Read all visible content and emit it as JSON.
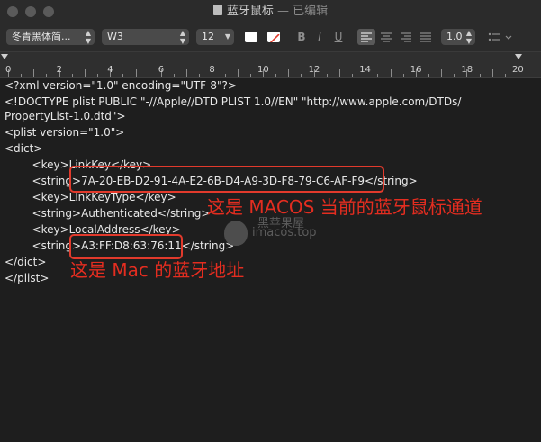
{
  "window": {
    "title": "蓝牙鼠标",
    "title_sep": "—",
    "status": "已编辑"
  },
  "toolbar": {
    "font_family": "冬青黑体简...",
    "font_weight": "W3",
    "font_size": "12",
    "bold": "B",
    "italic": "I",
    "underline": "U",
    "line_spacing": "1.0"
  },
  "ruler": {
    "labels": [
      "0",
      "2",
      "4",
      "6",
      "8",
      "10",
      "12",
      "14",
      "16",
      "18",
      "20"
    ]
  },
  "document": {
    "lines": [
      "<?xml version=\"1.0\" encoding=\"UTF-8\"?>",
      "<!DOCTYPE plist PUBLIC \"-//Apple//DTD PLIST 1.0//EN\" \"http://www.apple.com/DTDs/",
      "PropertyList-1.0.dtd\">",
      "<plist version=\"1.0\">",
      "<dict>",
      "        <key>LinkKey</key>",
      "        <string>7A-20-EB-D2-91-4A-E2-6B-D4-A9-3D-F8-79-C6-AF-F9</string>",
      "        <key>LinkKeyType</key>",
      "        <string>Authenticated</string>",
      "        <key>LocalAddress</key>",
      "        <string>A3:FF:D8:63:76:11</string>",
      "</dict>",
      "</plist>"
    ]
  },
  "annotations": {
    "link_key_note": "这是 MACOS 当前的蓝牙鼠标通道",
    "address_note": "这是 Mac 的蓝牙地址",
    "color": "#e23a2c"
  },
  "watermark": {
    "line1": "黑苹果屋",
    "line2": "imacos.top"
  }
}
